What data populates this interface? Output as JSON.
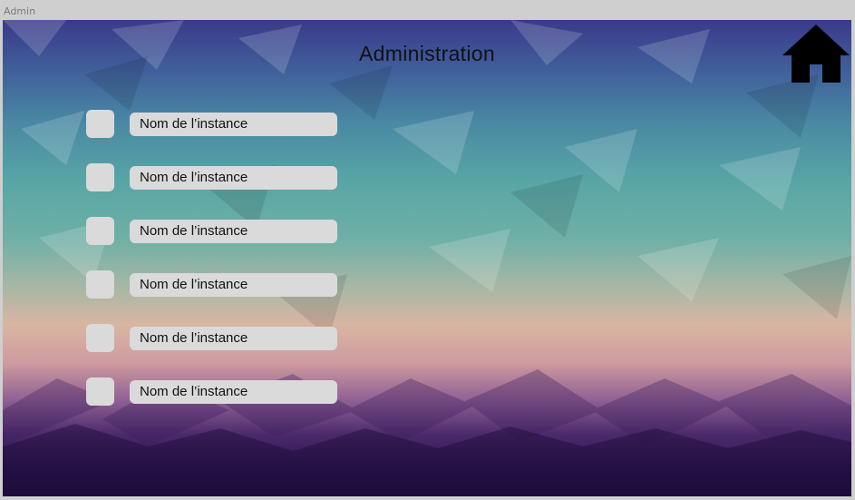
{
  "window": {
    "label": "Admin"
  },
  "header": {
    "title": "Administration"
  },
  "home_button": {
    "icon": "home-icon"
  },
  "instances": [
    {
      "label": "Nom de l’instance",
      "checked": false
    },
    {
      "label": "Nom de l’instance",
      "checked": false
    },
    {
      "label": "Nom de l’instance",
      "checked": false
    },
    {
      "label": "Nom de l’instance",
      "checked": false
    },
    {
      "label": "Nom de l’instance",
      "checked": false
    },
    {
      "label": "Nom de l’instance",
      "checked": false
    }
  ],
  "colors": {
    "field_bg": "#dadada",
    "text": "#111111",
    "home_icon": "#000000"
  }
}
